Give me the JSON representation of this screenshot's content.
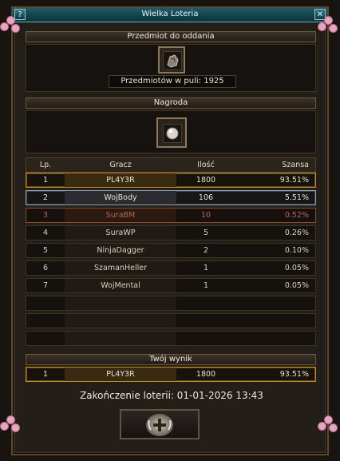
{
  "window": {
    "title": "Wielka Loteria",
    "help": "?",
    "close": "✕"
  },
  "sections": {
    "item": "Przedmiot do oddania",
    "reward": "Nagroda",
    "your_result": "Twój wynik"
  },
  "pool_text": "Przedmiotów w puli: 1925",
  "table": {
    "headers": [
      "Lp.",
      "Gracz",
      "Ilość",
      "Szansa"
    ],
    "rows": [
      {
        "lp": "1",
        "player": "PL4Y3R",
        "amount": "1800",
        "chance": "93.51%",
        "tier": "gold"
      },
      {
        "lp": "2",
        "player": "WojBody",
        "amount": "106",
        "chance": "5.51%",
        "tier": "silver"
      },
      {
        "lp": "3",
        "player": "SuraBM",
        "amount": "10",
        "chance": "0.52%",
        "tier": "bronze"
      },
      {
        "lp": "4",
        "player": "SuraWP",
        "amount": "5",
        "chance": "0.26%",
        "tier": "plain"
      },
      {
        "lp": "5",
        "player": "NinjaDagger",
        "amount": "2",
        "chance": "0.10%",
        "tier": "plain"
      },
      {
        "lp": "6",
        "player": "SzamanHeller",
        "amount": "1",
        "chance": "0.05%",
        "tier": "plain"
      },
      {
        "lp": "7",
        "player": "WojMental",
        "amount": "1",
        "chance": "0.05%",
        "tier": "plain"
      }
    ],
    "empty_rows": 3
  },
  "your_row": {
    "lp": "1",
    "player": "PL4Y3R",
    "amount": "1800",
    "chance": "93.51%"
  },
  "end_text": "Zakończenie loterii: 01-01-2026 13:43",
  "icons": {
    "item": "ore-stone-icon",
    "reward": "pearl-icon",
    "button": "plus-emblem-icon",
    "decor": "cherry-blossom-icon"
  },
  "colors": {
    "titlebar": "#1e5a66",
    "gold": "#c08a2a",
    "silver": "#8ea2b4",
    "bronze": "#8a4a2c"
  }
}
